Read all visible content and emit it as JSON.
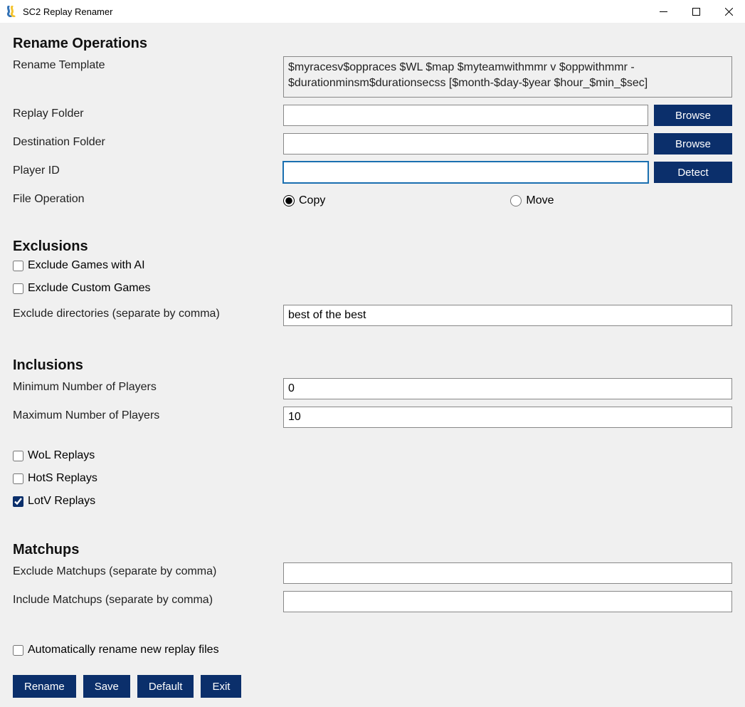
{
  "window": {
    "title": "SC2 Replay Renamer"
  },
  "section_rename_ops": {
    "heading": "Rename Operations",
    "template_label": "Rename Template",
    "template_value": "$myracesv$oppraces $WL $map $myteamwithmmr v $oppwithmmr - $durationminsm$durationsecss [$month-$day-$year $hour_$min_$sec]",
    "replay_folder_label": "Replay Folder",
    "replay_folder_value": "",
    "destination_folder_label": "Destination Folder",
    "destination_folder_value": "",
    "player_id_label": "Player ID",
    "player_id_value": "",
    "file_op_label": "File Operation",
    "radio_copy": "Copy",
    "radio_move": "Move",
    "browse_button": "Browse",
    "detect_button": "Detect"
  },
  "section_exclusions": {
    "heading": "Exclusions",
    "exclude_ai": "Exclude Games with AI",
    "exclude_custom": "Exclude Custom Games",
    "exclude_dirs_label": "Exclude directories (separate by comma)",
    "exclude_dirs_value": "best of the best"
  },
  "section_inclusions": {
    "heading": "Inclusions",
    "min_players_label": "Minimum Number of Players",
    "min_players_value": "0",
    "max_players_label": "Maximum Number of Players",
    "max_players_value": "10",
    "wol": "WoL Replays",
    "hots": "HotS Replays",
    "lotv": "LotV Replays"
  },
  "section_matchups": {
    "heading": "Matchups",
    "exclude_label": "Exclude Matchups (separate by comma)",
    "exclude_value": "",
    "include_label": "Include Matchups (separate by comma)",
    "include_value": ""
  },
  "auto_rename_label": "Automatically rename new replay files",
  "buttons": {
    "rename": "Rename",
    "save": "Save",
    "default": "Default",
    "exit": "Exit"
  }
}
